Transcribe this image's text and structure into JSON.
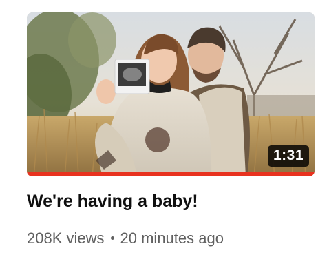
{
  "video": {
    "title": "We're having a baby!",
    "duration": "1:31",
    "views": "208K views",
    "published": "20 minutes ago",
    "watch_progress": 1.0
  },
  "colors": {
    "progress": "#e8321f",
    "title": "#0f0f0f",
    "meta": "#606060",
    "badge_bg": "#000000"
  }
}
